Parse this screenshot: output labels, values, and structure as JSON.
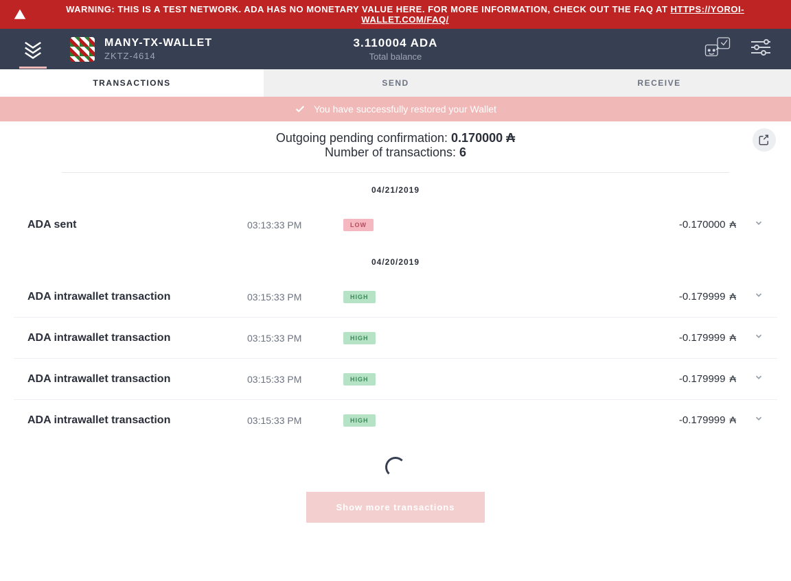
{
  "banner": {
    "prefix": "WARNING: THIS IS A TEST NETWORK. ADA HAS NO MONETARY VALUE HERE. FOR MORE INFORMATION, CHECK OUT THE FAQ AT ",
    "link": "HTTPS://YOROI-WALLET.COM/FAQ/"
  },
  "wallet": {
    "name": "MANY-TX-WALLET",
    "subid": "ZKTZ-4614"
  },
  "balance": {
    "value": "3.110004 ADA",
    "label": "Total balance"
  },
  "tabs": {
    "transactions": "TRANSACTIONS",
    "send": "SEND",
    "receive": "RECEIVE"
  },
  "notice": "You have successfully restored your Wallet",
  "summary": {
    "pending_label": "Outgoing pending confirmation: ",
    "pending_value": "0.170000",
    "count_label": "Number of transactions: ",
    "count_value": "6"
  },
  "currency_symbol": "₳",
  "dates": [
    "04/21/2019",
    "04/20/2019"
  ],
  "transactions": [
    {
      "title": "ADA sent",
      "time": "03:13:33 PM",
      "badge": "LOW",
      "badge_class": "low",
      "amount": "-0.170000"
    },
    {
      "title": "ADA intrawallet transaction",
      "time": "03:15:33 PM",
      "badge": "HIGH",
      "badge_class": "high",
      "amount": "-0.179999"
    },
    {
      "title": "ADA intrawallet transaction",
      "time": "03:15:33 PM",
      "badge": "HIGH",
      "badge_class": "high",
      "amount": "-0.179999"
    },
    {
      "title": "ADA intrawallet transaction",
      "time": "03:15:33 PM",
      "badge": "HIGH",
      "badge_class": "high",
      "amount": "-0.179999"
    },
    {
      "title": "ADA intrawallet transaction",
      "time": "03:15:33 PM",
      "badge": "HIGH",
      "badge_class": "high",
      "amount": "-0.179999"
    }
  ],
  "show_more": "Show more transactions"
}
